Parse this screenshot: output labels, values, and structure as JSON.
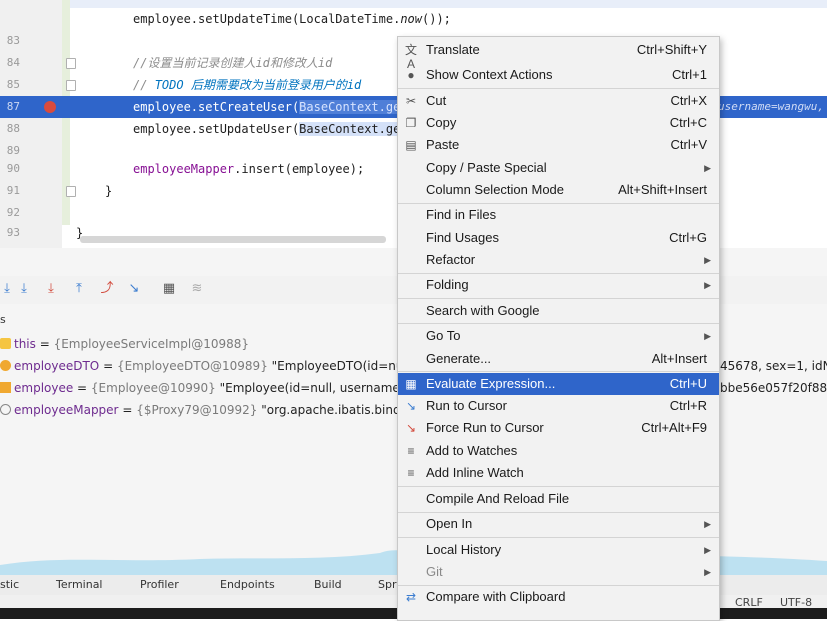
{
  "editor": {
    "lines": [
      {
        "num": "",
        "code": "employee.setUpdateTime(LocalDateTime.now());"
      },
      {
        "num": "83",
        "code": ""
      },
      {
        "num": "84",
        "code": "//设置当前记录创建人id和修改人id"
      },
      {
        "num": "85",
        "code": "// TODO 后期需要改为当前登录用户的id"
      },
      {
        "num": "87",
        "code_pre": "employee.setCreateUser(",
        "code_sel": "BaseContext.get",
        "hint": "username=wangwu,"
      },
      {
        "num": "88",
        "code_pre": "employee.setUpdateUser(",
        "code_sel": "BaseContext.get"
      },
      {
        "num": "89",
        "code": ""
      },
      {
        "num": "90",
        "code": "employeeMapper.insert(employee);"
      },
      {
        "num": "91",
        "code": "}"
      },
      {
        "num": "92",
        "code": ""
      },
      {
        "num": "93",
        "code": "}"
      }
    ],
    "todo_keyword": "TODO",
    "todo_text": "后期需要改为当前登录用户的id"
  },
  "debug": {
    "vars_label": "s",
    "variables": [
      {
        "name": "this",
        "value": "{EmployeeServiceImpl@10988}",
        "extra": ""
      },
      {
        "name": "employeeDTO",
        "value": "{EmployeeDTO@10989}",
        "extra": "\"EmployeeDTO(id=nul",
        "tail": "45678, sex=1, idNu"
      },
      {
        "name": "employee",
        "value": "{Employee@10990}",
        "extra": "\"Employee(id=null, username=",
        "tail": "bbe56e057f20f88"
      },
      {
        "name": "employeeMapper",
        "value": "{$Proxy79@10992}",
        "extra": "\"org.apache.ibatis.bind",
        "tail": ""
      }
    ]
  },
  "bottom_tabs": [
    "stic",
    "Terminal",
    "Profiler",
    "Endpoints",
    "Build",
    "Spri"
  ],
  "status": {
    "line_sep": "CRLF",
    "encoding": "UTF-8"
  },
  "context_menu": {
    "items": [
      {
        "icon": "translate-icon",
        "glyph": "文A",
        "label": "Translate",
        "shortcut": "Ctrl+Shift+Y"
      },
      {
        "icon": "bulb-icon",
        "glyph": "●",
        "label": "Show Context Actions",
        "shortcut": "Ctrl+1"
      },
      {
        "icon": "cut-icon",
        "glyph": "✂",
        "label": "Cut",
        "shortcut": "Ctrl+X",
        "u": "t"
      },
      {
        "icon": "copy-icon",
        "glyph": "❐",
        "label": "Copy",
        "shortcut": "Ctrl+C",
        "u": "C"
      },
      {
        "icon": "paste-icon",
        "glyph": "▤",
        "label": "Paste",
        "shortcut": "Ctrl+V",
        "u": "P"
      },
      {
        "icon": "",
        "glyph": "",
        "label": "Copy / Paste Special",
        "shortcut": "",
        "submenu": true
      },
      {
        "icon": "",
        "glyph": "",
        "label": "Column Selection Mode",
        "shortcut": "Alt+Shift+Insert",
        "u": "M"
      },
      {
        "icon": "",
        "glyph": "",
        "label": "Find in Files",
        "shortcut": ""
      },
      {
        "icon": "",
        "glyph": "",
        "label": "Find Usages",
        "shortcut": "Ctrl+G",
        "u": "U"
      },
      {
        "icon": "",
        "glyph": "",
        "label": "Refactor",
        "shortcut": "",
        "submenu": true,
        "u": "R"
      },
      {
        "icon": "",
        "glyph": "",
        "label": "Folding",
        "shortcut": "",
        "submenu": true
      },
      {
        "icon": "",
        "glyph": "",
        "label": "Search with Google",
        "shortcut": "",
        "u": "S"
      },
      {
        "icon": "",
        "glyph": "",
        "label": "Go To",
        "shortcut": "",
        "submenu": true
      },
      {
        "icon": "",
        "glyph": "",
        "label": "Generate...",
        "shortcut": "Alt+Insert"
      },
      {
        "icon": "evaluate-icon",
        "glyph": "▦",
        "label": "Evaluate Expression...",
        "shortcut": "Ctrl+U",
        "active": true,
        "u": "x"
      },
      {
        "icon": "run-to-cursor-icon",
        "glyph": "↘",
        "label": "Run to Cursor",
        "shortcut": "Ctrl+R",
        "u": "C"
      },
      {
        "icon": "force-run-to-cursor-icon",
        "glyph": "↘",
        "label": "Force Run to Cursor",
        "shortcut": "Ctrl+Alt+F9",
        "u": "s"
      },
      {
        "icon": "add-watch-icon",
        "glyph": "≡",
        "label": "Add to Watches",
        "shortcut": ""
      },
      {
        "icon": "inline-watch-icon",
        "glyph": "≡",
        "label": "Add Inline Watch",
        "shortcut": ""
      },
      {
        "icon": "",
        "glyph": "",
        "label": "Compile And Reload File",
        "shortcut": ""
      },
      {
        "icon": "",
        "glyph": "",
        "label": "Open In",
        "shortcut": "",
        "submenu": true
      },
      {
        "icon": "",
        "glyph": "",
        "label": "Local History",
        "shortcut": "",
        "submenu": true,
        "u": "H"
      },
      {
        "icon": "",
        "glyph": "",
        "label": "Git",
        "shortcut": "",
        "submenu": true
      },
      {
        "icon": "compare-clipboard-icon",
        "glyph": "⇄",
        "label": "Compare with Clipboard",
        "shortcut": "",
        "u": "b"
      }
    ]
  },
  "colors": {
    "selection": "#2f65ca",
    "menu_bg": "#f2f2f2"
  }
}
